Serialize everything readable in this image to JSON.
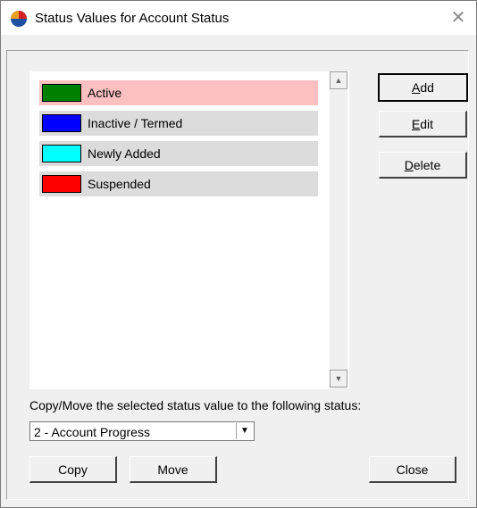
{
  "window": {
    "title": "Status Values for Account Status"
  },
  "status_list": {
    "items": [
      {
        "label": "Active",
        "color": "#008000",
        "selected": true
      },
      {
        "label": "Inactive / Termed",
        "color": "#0000ff",
        "selected": false
      },
      {
        "label": "Newly Added",
        "color": "#00ffff",
        "selected": false
      },
      {
        "label": "Suspended",
        "color": "#ff0000",
        "selected": false
      }
    ]
  },
  "buttons": {
    "add": {
      "mnemonic": "A",
      "rest": "dd"
    },
    "edit": {
      "mnemonic": "E",
      "rest": "dit"
    },
    "delete": {
      "mnemonic": "D",
      "rest": "elete"
    },
    "copy": "Copy",
    "move": "Move",
    "close": "Close"
  },
  "copy_move": {
    "label": "Copy/Move the selected status value to the following status:",
    "selected": "2 - Account Progress"
  },
  "colors": {
    "selected_row": "#fcc0c0",
    "row": "#dcdcdc",
    "dialog_bg": "#f0f0f0"
  }
}
